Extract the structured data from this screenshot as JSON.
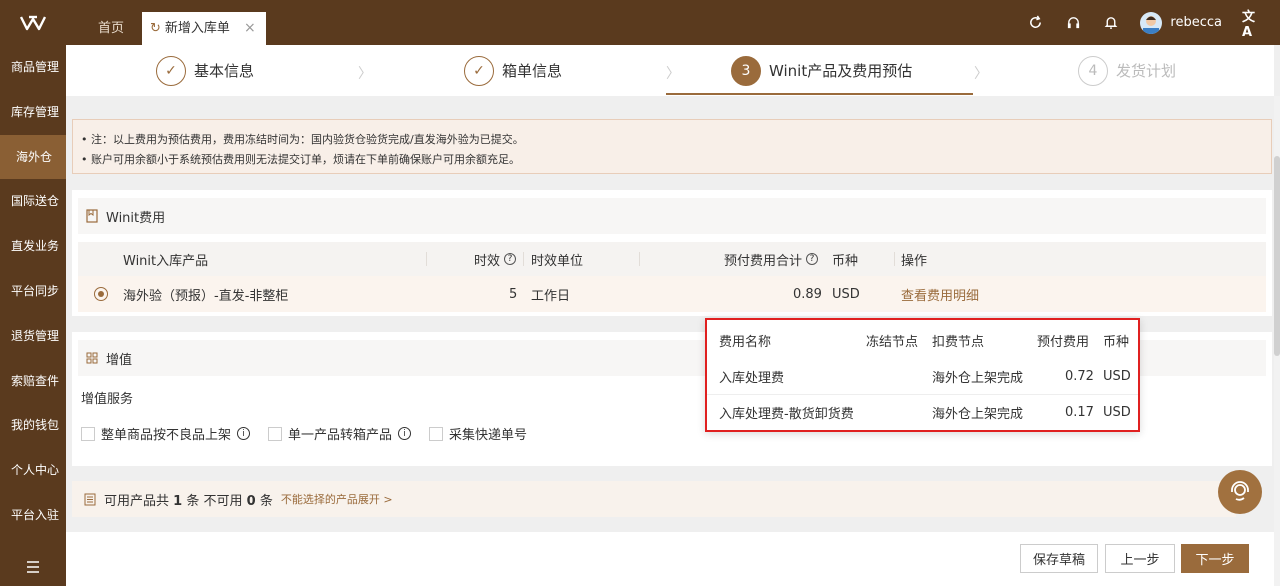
{
  "header": {
    "tabs": [
      {
        "label": "首页"
      },
      {
        "label": "新增入库单"
      }
    ],
    "user_name": "rebecca"
  },
  "sidebar": {
    "items": [
      {
        "label": "商品管理"
      },
      {
        "label": "库存管理"
      },
      {
        "label": "海外仓"
      },
      {
        "label": "国际送仓"
      },
      {
        "label": "直发业务"
      },
      {
        "label": "平台同步"
      },
      {
        "label": "退货管理"
      },
      {
        "label": "索赔查件"
      },
      {
        "label": "我的钱包"
      },
      {
        "label": "个人中心"
      },
      {
        "label": "平台入驻"
      }
    ]
  },
  "steps": [
    {
      "num": "1",
      "label": "基本信息",
      "state": "done"
    },
    {
      "num": "2",
      "label": "箱单信息",
      "state": "done"
    },
    {
      "num": "3",
      "label": "Winit产品及费用预估",
      "state": "current"
    },
    {
      "num": "4",
      "label": "发货计划",
      "state": "pending"
    }
  ],
  "notice": {
    "line1": "• 注：以上费用为预估费用，费用冻结时间为：国内验货仓验货完成/直发海外验为已提交。",
    "line2": "• 账户可用余额小于系统预估费用则无法提交订单，烦请在下单前确保账户可用余额充足。"
  },
  "fees": {
    "title": "Winit费用",
    "columns": {
      "product": "Winit入库产品",
      "timeliness": "时效",
      "unit": "时效单位",
      "total": "预付费用合计",
      "currency": "币种",
      "action": "操作"
    },
    "row": {
      "product": "海外验（预报）-直发-非整柜",
      "timeliness": "5",
      "unit": "工作日",
      "total": "0.89",
      "currency": "USD",
      "action": "查看费用明细"
    }
  },
  "value_added": {
    "title": "增值",
    "label": "增值服务",
    "options": [
      {
        "label": "整单商品按不良品上架",
        "info": true
      },
      {
        "label": "单一产品转箱产品",
        "info": true
      },
      {
        "label": "采集快递单号",
        "info": false
      }
    ]
  },
  "available": {
    "prefix": "可用产品共",
    "available_count": "1",
    "middle": "条 不可用",
    "unavailable_count": "0",
    "suffix": "条",
    "expand_link": "不能选择的产品展开 >"
  },
  "footer": {
    "save_draft": "保存草稿",
    "prev": "上一步",
    "next": "下一步"
  },
  "fee_popover": {
    "columns": {
      "name": "费用名称",
      "freeze": "冻结节点",
      "deduct": "扣费节点",
      "fee": "预付费用",
      "currency": "币种"
    },
    "rows": [
      {
        "name": "入库处理费",
        "freeze": "",
        "deduct": "海外仓上架完成",
        "fee": "0.72",
        "currency": "USD"
      },
      {
        "name": "入库处理费-散货卸货费",
        "freeze": "",
        "deduct": "海外仓上架完成",
        "fee": "0.17",
        "currency": "USD"
      }
    ]
  },
  "colors": {
    "brand_dark": "#5a3a1e",
    "brand": "#9a6b3c",
    "highlight_border": "#e02020"
  }
}
